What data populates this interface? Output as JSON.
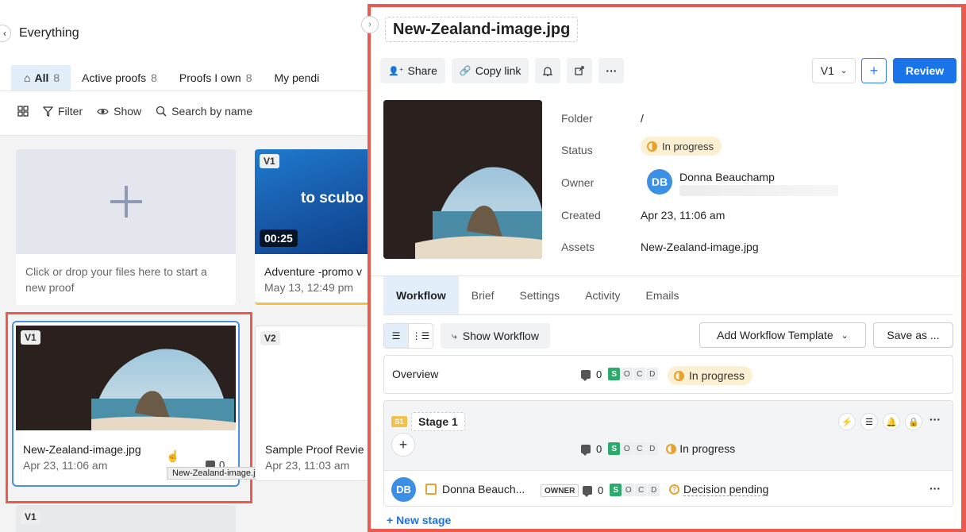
{
  "left": {
    "title": "Everything",
    "tabs": [
      {
        "label": "All",
        "count": "8"
      },
      {
        "label": "Active proofs",
        "count": "8"
      },
      {
        "label": "Proofs I own",
        "count": "8"
      },
      {
        "label": "My pendi",
        "count": ""
      }
    ],
    "toolbar": {
      "filter": "Filter",
      "show": "Show",
      "search": "Search by name"
    },
    "upload_hint": "Click or drop your files here to start a new proof",
    "cards": [
      {
        "version": "V1",
        "duration": "00:25",
        "thumb_text": "to scubo",
        "name": "Adventure -promo v",
        "date": "May 13, 12:49 pm"
      },
      {
        "version": "V1",
        "name": "New-Zealand-image.jpg",
        "date": "Apr 23, 11:06 am",
        "comments": "0",
        "tooltip": "New-Zealand-image.jpg"
      },
      {
        "version": "V2",
        "name": "Sample Proof Revie",
        "date": "Apr 23, 11:03 am"
      },
      {
        "version": "V1"
      }
    ]
  },
  "panel": {
    "title": "New-Zealand-image.jpg",
    "actions": {
      "share": "Share",
      "copy_link": "Copy link",
      "more": "···"
    },
    "version": "V1",
    "review": "Review",
    "meta": {
      "folder_label": "Folder",
      "folder": "/",
      "status_label": "Status",
      "status": "In progress",
      "owner_label": "Owner",
      "owner_initials": "DB",
      "owner_name": "Donna Beauchamp",
      "created_label": "Created",
      "created": "Apr 23, 11:06 am",
      "assets_label": "Assets",
      "assets": "New-Zealand-image.jpg"
    },
    "tabs": [
      "Workflow",
      "Brief",
      "Settings",
      "Activity",
      "Emails"
    ],
    "workflow": {
      "show_workflow": "Show Workflow",
      "add_template": "Add Workflow Template",
      "save_as": "Save as ...",
      "overview": {
        "label": "Overview",
        "comments": "0",
        "letters": [
          "S",
          "O",
          "C",
          "D"
        ],
        "status": "In progress"
      },
      "stage": {
        "badge": "S1",
        "name": "Stage 1",
        "comments": "0",
        "status": "In progress",
        "more": "···",
        "reviewer": {
          "initials": "DB",
          "name": "Donna Beauch...",
          "role": "OWNER",
          "comments": "0",
          "decision": "Decision pending",
          "more": "···"
        }
      },
      "new_stage": "+ New stage"
    }
  },
  "colors": {
    "accent": "#1a73e8",
    "highlight": "#ea5a4e",
    "pending": "#fcefd2",
    "approved": "#2eaa6c"
  }
}
